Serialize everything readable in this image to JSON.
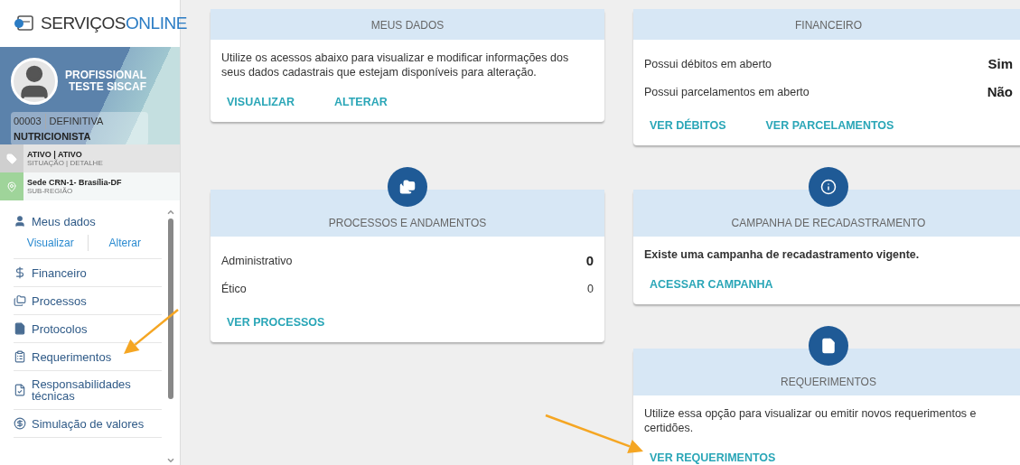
{
  "sidebar": {
    "logo": {
      "first": "SERVIÇOS",
      "second": "ONLINE"
    },
    "profile": {
      "name": "PROFISSIONAL TESTE SISCAF",
      "number": "00003",
      "registration": "DEFINITIVA",
      "profession": "NUTRICIONISTA"
    },
    "status": {
      "value": "ATIVO | ATIVO",
      "label": "SITUAÇÃO | DETALHE"
    },
    "region": {
      "value": "Sede CRN-1- Brasília-DF",
      "label": "SUB-REGIÃO"
    },
    "menu": [
      {
        "label": "Meus dados",
        "links": [
          "Visualizar",
          "Alterar"
        ]
      },
      {
        "label": "Financeiro"
      },
      {
        "label": "Processos"
      },
      {
        "label": "Protocolos"
      },
      {
        "label": "Requerimentos"
      },
      {
        "label": "Responsabilidades técnicas"
      },
      {
        "label": "Simulação de valores"
      }
    ]
  },
  "columns": [
    [
      {
        "kind": "plain",
        "title": "MEUS DADOS",
        "description": "Utilize os acessos abaixo para visualizar e modificar informações dos seus dados cadastrais que estejam disponíveis para alteração.",
        "description_bold": false,
        "links": [
          "VISUALIZAR",
          "ALTERAR"
        ]
      },
      {
        "kind": "badge",
        "title": "PROCESSOS E ANDAMENTOS",
        "rows": [
          {
            "label": "Administrativo",
            "value": "0",
            "bold": true
          },
          {
            "label": "Ético",
            "value": "0",
            "bold": false
          }
        ],
        "links": [
          "VER PROCESSOS"
        ]
      }
    ],
    [
      {
        "kind": "plain",
        "title": "FINANCEIRO",
        "rows": [
          {
            "label": "Possui débitos em aberto",
            "value": "Sim",
            "bold": true
          },
          {
            "label": "Possui parcelamentos em aberto",
            "value": "Não",
            "bold": true
          }
        ],
        "links": [
          "VER DÉBITOS",
          "VER PARCELAMENTOS"
        ]
      },
      {
        "kind": "badge",
        "title": "CAMPANHA DE RECADASTRAMENTO",
        "description": "Existe uma campanha de recadastramento vigente.",
        "description_bold": true,
        "links": [
          "ACESSAR CAMPANHA"
        ]
      },
      {
        "kind": "badge",
        "title": "REQUERIMENTOS",
        "description": "Utilize essa opção para visualizar ou emitir novos requerimentos e certidões.",
        "description_bold": false,
        "links": [
          "VER REQUERIMENTOS"
        ]
      }
    ]
  ]
}
